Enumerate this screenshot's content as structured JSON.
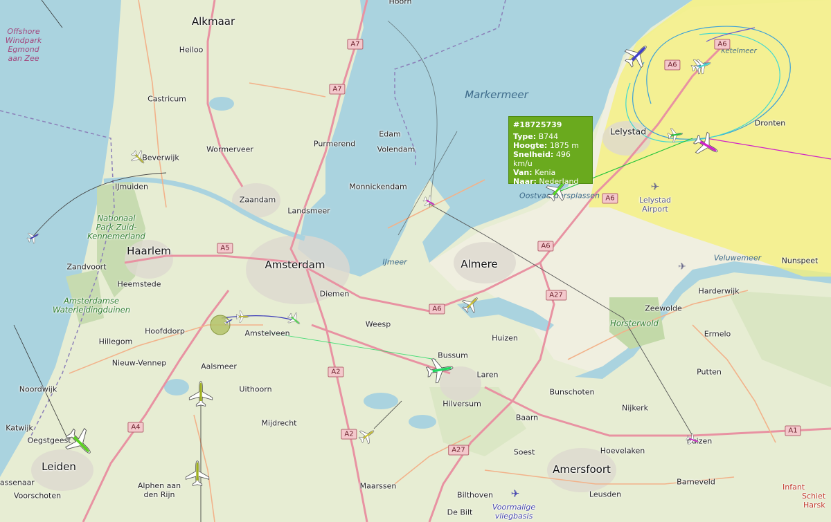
{
  "map": {
    "places": {
      "alkmaar": "Alkmaar",
      "heiloo": "Heiloo",
      "castricum": "Castricum",
      "beverwijk": "Beverwijk",
      "ijmuiden": "IJmuiden",
      "wormerveer": "Wormerveer",
      "purmerend": "Purmerend",
      "edam": "Edam",
      "volendam": "Volendam",
      "monnickendam": "Monnickendam",
      "zaandam": "Zaandam",
      "landsmeer": "Landsmeer",
      "haarlem": "Haarlem",
      "zandvoort": "Zandvoort",
      "heemstede": "Heemstede",
      "amsterdam": "Amsterdam",
      "diemen": "Diemen",
      "almere": "Almere",
      "lelystad": "Lelystad",
      "dronten": "Dronten",
      "hoofddorp": "Hoofddorp",
      "amstelveen": "Amstelveen",
      "weesp": "Weesp",
      "hillegom": "Hillegom",
      "nieuw_vennep": "Nieuw-Vennep",
      "aalsmeer": "Aalsmeer",
      "uithoorn": "Uithoorn",
      "noordwijk": "Noordwijk",
      "katwijk": "Katwijk",
      "oegstgeest": "Oegstgeest",
      "leiden": "Leiden",
      "sassenaar": "sassenaar",
      "voorschoten": "Voorschoten",
      "alphen": "Alphen aan\nden Rijn",
      "mijdrecht": "Mijdrecht",
      "hilversum": "Hilversum",
      "bussum": "Bussum",
      "huizen": "Huizen",
      "laren": "Laren",
      "baarn": "Baarn",
      "soest": "Soest",
      "bunschoten": "Bunschoten",
      "nijkerk": "Nijkerk",
      "hoevelaken": "Hoevelaken",
      "amersfoort": "Amersfoort",
      "leusden": "Leusden",
      "barneveld": "Barneveld",
      "putten": "Putten",
      "ermelo": "Ermelo",
      "harderwijk": "Harderwijk",
      "zeewolde": "Zeewolde",
      "nunspeet": "Nunspeet",
      "maarssen": "Maarssen",
      "bilthoven": "Bilthoven",
      "de_bilt": "De Bilt",
      "spakenburg": "huizen",
      "hoorn": "Hoorn"
    },
    "water": {
      "markermeer": "Markermeer",
      "ijmeer": "IJmeer",
      "ketelmeer": "Ketelmeer",
      "oostvaardersplassen": "Oostvaardersplassen",
      "veluwemeer": "Veluwemeer"
    },
    "parks": {
      "kennemerland": "Nationaal\nPark Zuid-\nKennemerland",
      "waterleiding": "Amsterdamse\nWaterleidingduinen",
      "horsterwold": "Horsterwold"
    },
    "windpark": "Offshore\nWindpark\nEgmond\naan Zee",
    "airports": {
      "lelystad": "Lelystad\nAirport",
      "soesterberg": "Voormalige\nvliegbasis"
    },
    "roads": [
      "A7",
      "A7",
      "A5",
      "A6",
      "A6",
      "A6",
      "A6",
      "A6",
      "A27",
      "A27",
      "A2",
      "A2",
      "A4",
      "A1"
    ],
    "partial": {
      "schiek_1": "Infant",
      "schiek_2": "Schiet",
      "schiek_3": "Harsk"
    }
  },
  "popup": {
    "id": "#18725739",
    "type_label": "Type:",
    "type_value": "B744",
    "alt_label": "Hoogte:",
    "alt_value": "1875 m",
    "speed_label": "Snelheid:",
    "speed_value": "496 km/u",
    "from_label": "Van:",
    "from_value": "Kenia",
    "to_label": "Naar:",
    "to_value": "Nederland"
  },
  "colors": {
    "sea": "#aad3df",
    "land": "#e7edd3",
    "yellow_zone": "#f6f07a",
    "motorway": "#e892a2",
    "primary": "#fcd6a4",
    "popup_bg": "#6aaa1e"
  },
  "aircraft": [
    {
      "icon": "airplane-icon",
      "color": "#3e3ec8"
    },
    {
      "icon": "airplane-icon",
      "color": "#3aa0d8"
    },
    {
      "icon": "airplane-icon",
      "color": "#40d8d0"
    },
    {
      "icon": "airplane-icon",
      "color": "#22c43a"
    },
    {
      "icon": "airplane-icon",
      "color": "#d020c8"
    },
    {
      "icon": "airplane-icon",
      "color": "#52d820"
    },
    {
      "icon": "airplane-icon",
      "color": "#3a3ab8"
    },
    {
      "icon": "airplane-icon",
      "color": "#d020c8"
    },
    {
      "icon": "airplane-icon",
      "color": "#b8b830"
    },
    {
      "icon": "airplane-icon",
      "color": "#c8c030"
    },
    {
      "icon": "airplane-icon",
      "color": "#48d848"
    },
    {
      "icon": "airplane-icon",
      "color": "#22d860"
    },
    {
      "icon": "airplane-icon",
      "color": "#a0b020"
    },
    {
      "icon": "airplane-icon",
      "color": "#a0b020"
    },
    {
      "icon": "airplane-icon",
      "color": "#b8b020"
    },
    {
      "icon": "airplane-icon",
      "color": "#5ad020"
    },
    {
      "icon": "airplane-icon",
      "color": "#3a3ab8"
    },
    {
      "icon": "airplane-icon",
      "color": "#d020c8"
    },
    {
      "icon": "airplane-icon",
      "color": "#c8c030"
    },
    {
      "icon": "airplane-icon",
      "color": "#b8b830"
    }
  ]
}
